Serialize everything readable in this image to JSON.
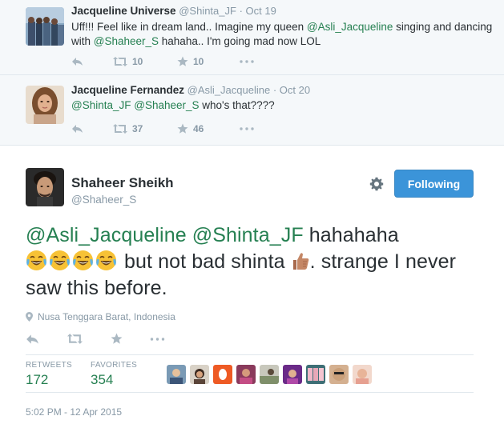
{
  "replies": [
    {
      "fullname": "Jacqueline Universe",
      "handle": "@Shinta_JF",
      "separator": "·",
      "date": "Oct 19",
      "text_1": "Uff!!! Feel like in dream land.. Imagine my queen ",
      "mention_1": "@Asli_Jacqueline",
      "text_2": " singing and dancing with ",
      "mention_2": "@Shaheer_S",
      "text_3": " hahaha.. I'm going mad now LOL",
      "retweets": "10",
      "favorites": "10"
    },
    {
      "fullname": "Jacqueline Fernandez",
      "handle": "@Asli_Jacqueline",
      "separator": "·",
      "date": "Oct 20",
      "mention_1": "@Shinta_JF",
      "mention_2": "@Shaheer_S",
      "text_1": " who's that????",
      "retweets": "37",
      "favorites": "46"
    }
  ],
  "main": {
    "fullname": "Shaheer Sheikh",
    "handle": "@Shaheer_S",
    "follow_label": "Following",
    "mention_1": "@Asli_Jacqueline",
    "mention_2": "@Shinta_JF",
    "text_1": " hahahaha",
    "text_2": "but not bad shinta ",
    "text_3": ". strange I never saw this before.",
    "location": "Nusa Tenggara Barat, Indonesia",
    "retweets_label": "RETWEETS",
    "retweets": "172",
    "favorites_label": "FAVORITES",
    "favorites": "354",
    "timestamp": "5:02 PM - 12 Apr 2015"
  },
  "icons": {
    "reply": "reply-icon",
    "retweet": "retweet-icon",
    "favorite": "star-icon",
    "more": "more-icon",
    "settings": "gear-icon",
    "location": "location-pin-icon",
    "emoji": "face-with-tears-of-joy-emoji",
    "thumb": "thumbs-up-emoji"
  },
  "colors": {
    "link": "#268052",
    "follow_button": "#3b94d9",
    "muted": "#8899a6",
    "reply_background": "#f5f8fa"
  }
}
